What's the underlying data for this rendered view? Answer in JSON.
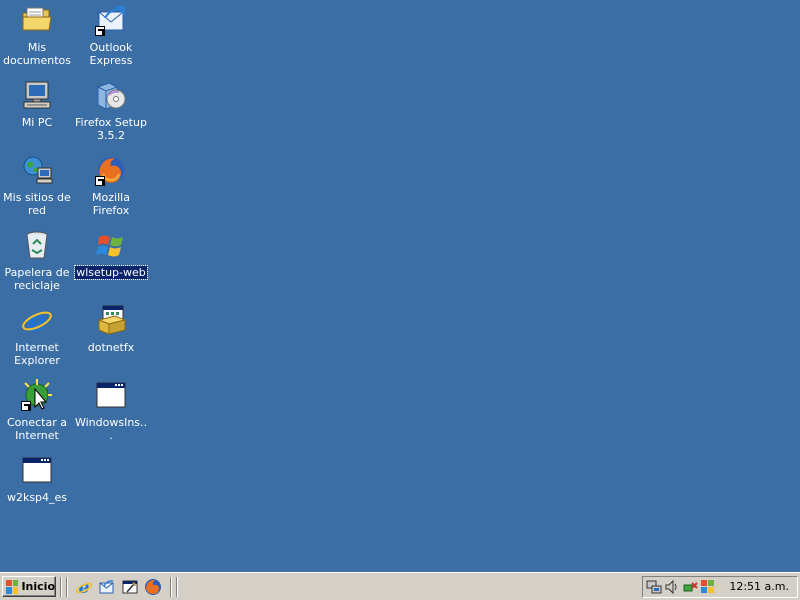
{
  "desktop": {
    "background": "#3A6EA5",
    "icons": [
      {
        "label": "Mis documentos",
        "icon": "my-documents-folder-icon"
      },
      {
        "label": "Mi PC",
        "icon": "my-computer-icon"
      },
      {
        "label": "Mis sitios de red",
        "icon": "network-places-icon"
      },
      {
        "label": "Papelera de reciclaje",
        "icon": "recycle-bin-icon"
      },
      {
        "label": "Internet Explorer",
        "icon": "internet-explorer-icon"
      },
      {
        "label": "Conectar a Internet",
        "icon": "connect-to-internet-icon"
      },
      {
        "label": "w2ksp4_es",
        "icon": "application-window-icon"
      },
      {
        "label": "Outlook Express",
        "icon": "outlook-express-icon"
      },
      {
        "label": "Firefox Setup 3.5.2",
        "icon": "installer-cd-box-icon"
      },
      {
        "label": "Mozilla Firefox",
        "icon": "firefox-icon"
      },
      {
        "label": "wlsetup-web",
        "icon": "windows-flag-icon",
        "selected": true
      },
      {
        "label": "dotnetfx",
        "icon": "installer-package-icon"
      },
      {
        "label": "WindowsIns...",
        "icon": "application-window-icon"
      }
    ]
  },
  "taskbar": {
    "start_label": "Inicio",
    "quick_launch": [
      "internet-explorer-icon",
      "outlook-express-icon",
      "show-desktop-icon",
      "firefox-icon"
    ],
    "tray_icons": [
      "network-icon",
      "volume-icon",
      "safely-remove-hardware-icon",
      "windows-update-icon"
    ],
    "clock": "12:51 a.m."
  }
}
